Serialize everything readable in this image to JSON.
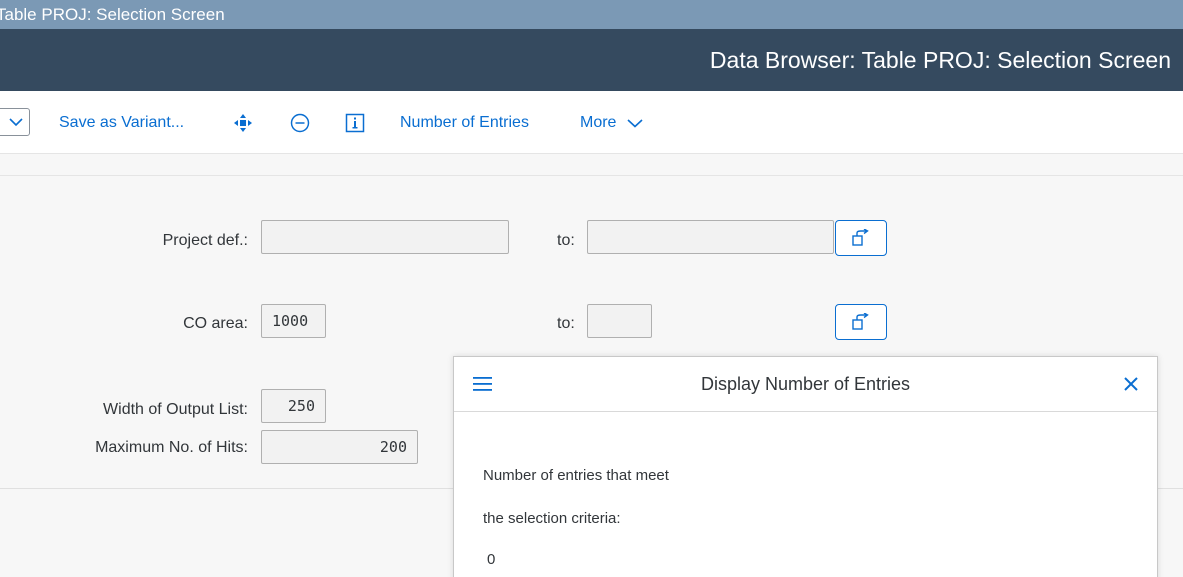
{
  "window": {
    "title": "Table PROJ: Selection Screen"
  },
  "shell": {
    "title": "Data Browser: Table PROJ: Selection Screen"
  },
  "toolbar": {
    "save_variant": "Save as Variant...",
    "number_of_entries": "Number of Entries",
    "more": "More",
    "icons": [
      "chevron-down-icon",
      "move-icon",
      "minus-circle-icon",
      "info-icon",
      "chevron-down-icon"
    ]
  },
  "form": {
    "project_def_label": "Project def.:",
    "project_def_from": "",
    "project_def_to_label": "to:",
    "project_def_to": "",
    "co_area_label": "CO area:",
    "co_area_from": "1000",
    "co_area_to_label": "to:",
    "co_area_to": "",
    "width_label": "Width of Output List:",
    "width_value": "250",
    "max_hits_label": "Maximum No. of Hits:",
    "max_hits_value": "200"
  },
  "dialog": {
    "title": "Display Number of Entries",
    "line1": "Number of entries that meet",
    "line2": "the selection criteria:",
    "count": "0"
  },
  "colors": {
    "title_bar": "#7b99b5",
    "shell_bar": "#354a5f",
    "accent": "#0a6ed1"
  }
}
